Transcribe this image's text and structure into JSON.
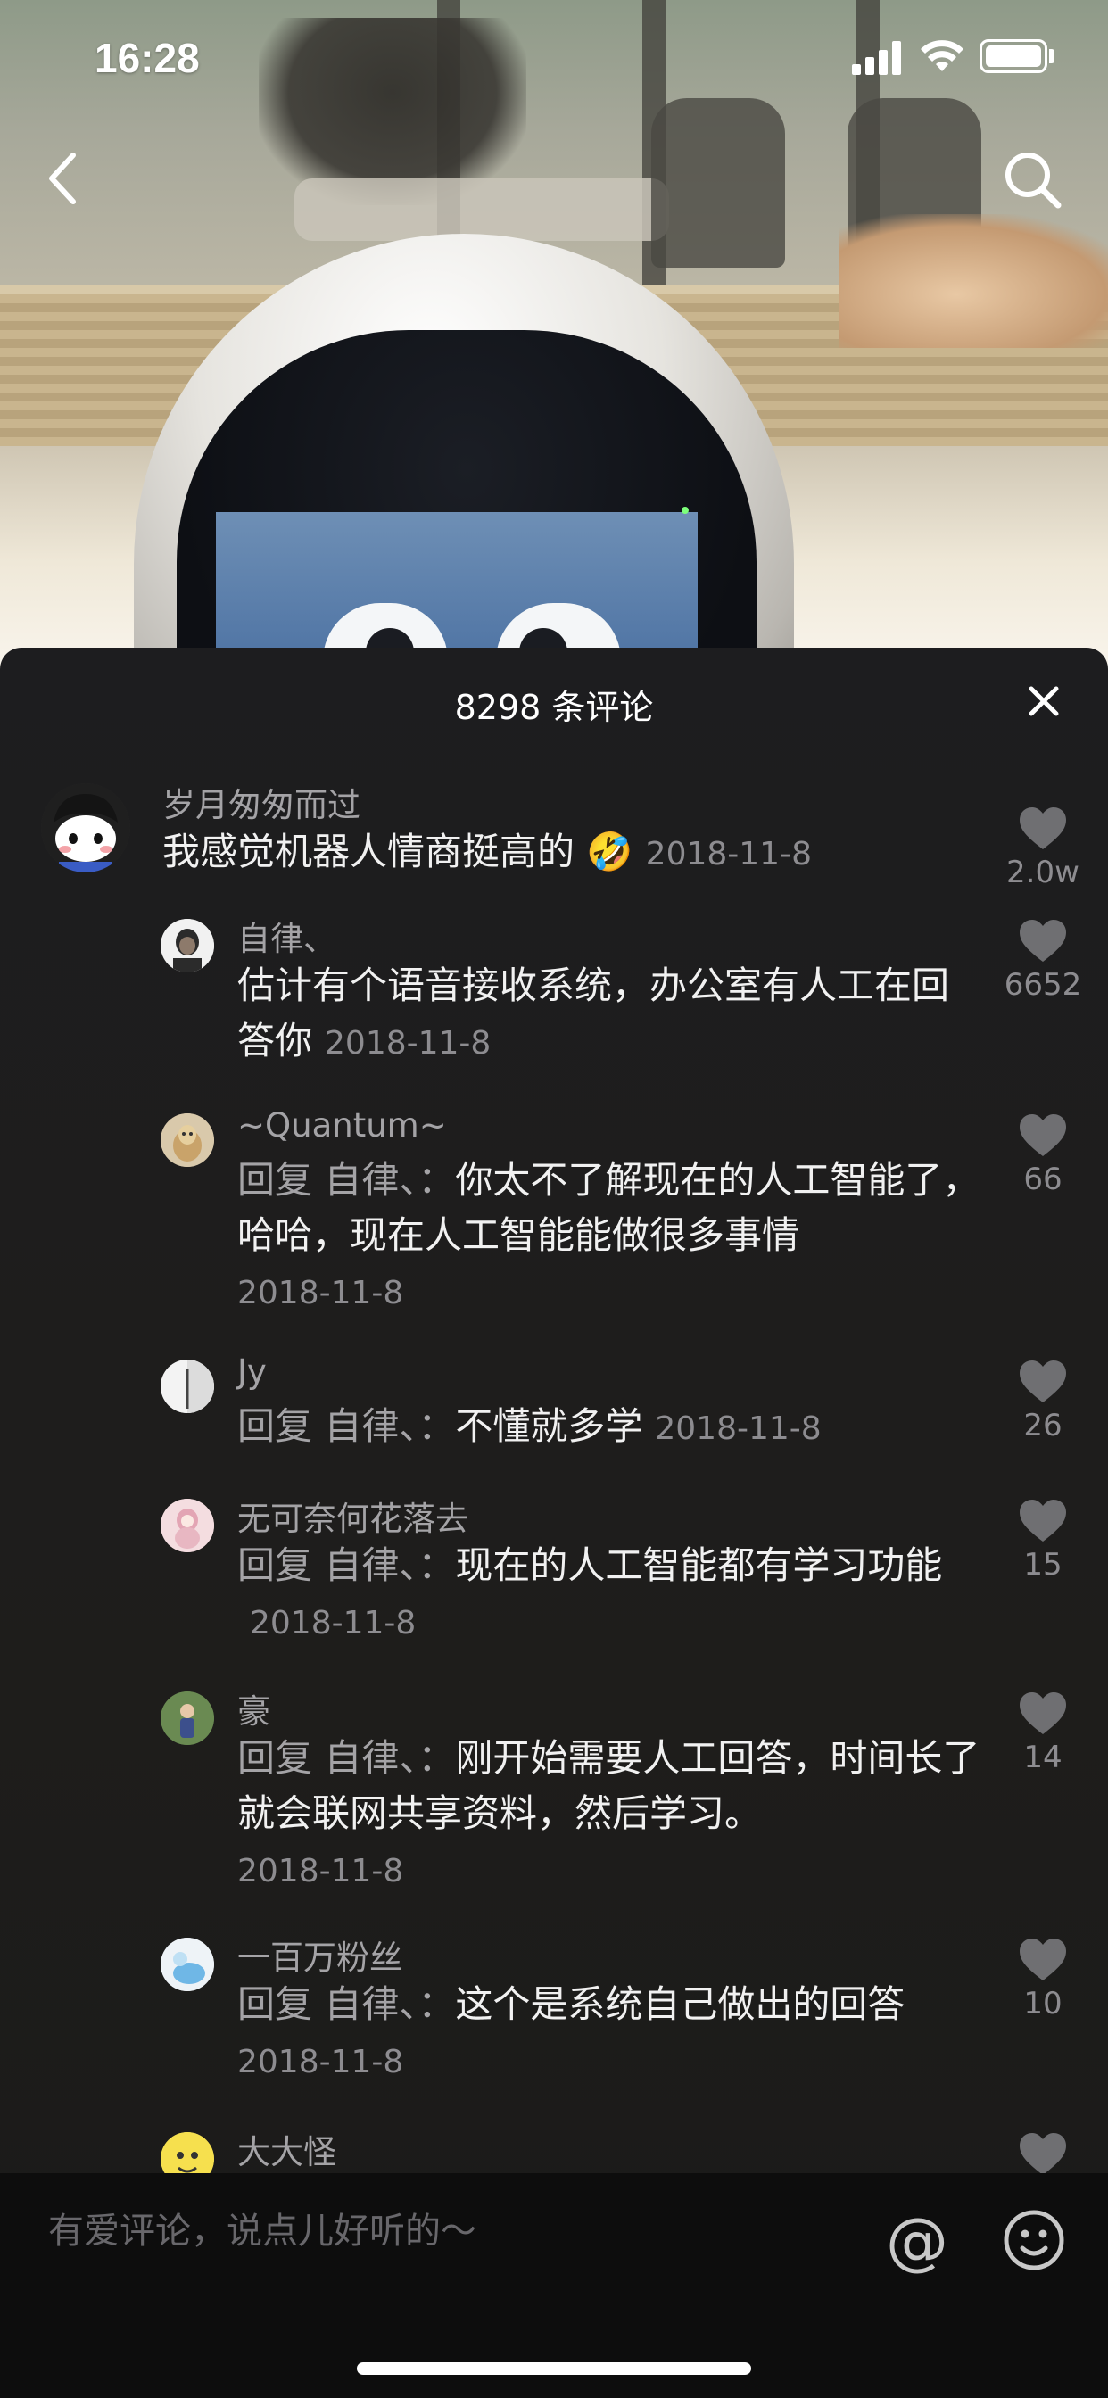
{
  "status_bar": {
    "time": "16:28"
  },
  "sheet": {
    "title": "8298 条评论"
  },
  "comments": [
    {
      "user": "岁月匆匆而过",
      "text": "我感觉机器人情商挺高的",
      "emoji": "🤣",
      "date": "2018-11-8",
      "likes": "2.0w"
    },
    {
      "user": "自律、",
      "text": "估计有个语音接收系统，办公室有人工在回答你",
      "date": "2018-11-8",
      "likes": "6652"
    },
    {
      "user": "~Quantum~",
      "reply_prefix": "回复 自律、：",
      "text": "你太不了解现在的人工智能了，哈哈，现在人工智能能做很多事情",
      "date": "2018-11-8",
      "likes": "66"
    },
    {
      "user": "Jy",
      "reply_prefix": "回复 自律、：",
      "text": "不懂就多学",
      "date": "2018-11-8",
      "likes": "26"
    },
    {
      "user": "无可奈何花落去",
      "reply_prefix": "回复 自律、：",
      "text": "现在的人工智能都有学习功能",
      "date": "2018-11-8",
      "likes": "15"
    },
    {
      "user": "豪",
      "reply_prefix": "回复 自律、：",
      "text": "刚开始需要人工回答，时间长了就会联网共享资料，然后学习。",
      "date": "2018-11-8",
      "likes": "14"
    },
    {
      "user": "一百万粉丝",
      "reply_prefix": "回复 自律、：",
      "text": "这个是系统自己做出的回答",
      "date": "2018-11-8",
      "likes": "10"
    },
    {
      "user": "大大怪"
    }
  ],
  "input": {
    "placeholder": "有爱评论，说点儿好听的～",
    "at_symbol": "@"
  }
}
